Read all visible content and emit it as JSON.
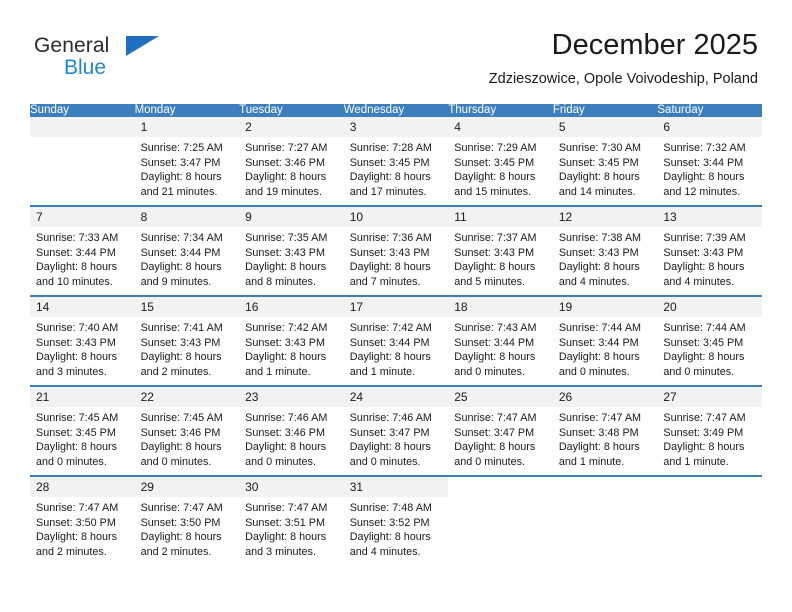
{
  "brand": {
    "name_part1": "General",
    "name_part2": "Blue",
    "color_dark": "#2b2b2b",
    "color_blue": "#1f86d6",
    "triangle_color": "#1f6fc0"
  },
  "header": {
    "title": "December 2025",
    "location": "Zdzieszowice, Opole Voivodeship, Poland"
  },
  "calendar": {
    "accent_color": "#3d7ebd",
    "daynum_band_color": "#f2f2f2",
    "weekday_headers": [
      "Sunday",
      "Monday",
      "Tuesday",
      "Wednesday",
      "Thursday",
      "Friday",
      "Saturday"
    ],
    "weeks": [
      [
        {
          "day": "",
          "empty": true
        },
        {
          "day": "1",
          "sunrise": "Sunrise: 7:25 AM",
          "sunset": "Sunset: 3:47 PM",
          "daylight_line1": "Daylight: 8 hours",
          "daylight_line2": "and 21 minutes."
        },
        {
          "day": "2",
          "sunrise": "Sunrise: 7:27 AM",
          "sunset": "Sunset: 3:46 PM",
          "daylight_line1": "Daylight: 8 hours",
          "daylight_line2": "and 19 minutes."
        },
        {
          "day": "3",
          "sunrise": "Sunrise: 7:28 AM",
          "sunset": "Sunset: 3:45 PM",
          "daylight_line1": "Daylight: 8 hours",
          "daylight_line2": "and 17 minutes."
        },
        {
          "day": "4",
          "sunrise": "Sunrise: 7:29 AM",
          "sunset": "Sunset: 3:45 PM",
          "daylight_line1": "Daylight: 8 hours",
          "daylight_line2": "and 15 minutes."
        },
        {
          "day": "5",
          "sunrise": "Sunrise: 7:30 AM",
          "sunset": "Sunset: 3:45 PM",
          "daylight_line1": "Daylight: 8 hours",
          "daylight_line2": "and 14 minutes."
        },
        {
          "day": "6",
          "sunrise": "Sunrise: 7:32 AM",
          "sunset": "Sunset: 3:44 PM",
          "daylight_line1": "Daylight: 8 hours",
          "daylight_line2": "and 12 minutes."
        }
      ],
      [
        {
          "day": "7",
          "sunrise": "Sunrise: 7:33 AM",
          "sunset": "Sunset: 3:44 PM",
          "daylight_line1": "Daylight: 8 hours",
          "daylight_line2": "and 10 minutes."
        },
        {
          "day": "8",
          "sunrise": "Sunrise: 7:34 AM",
          "sunset": "Sunset: 3:44 PM",
          "daylight_line1": "Daylight: 8 hours",
          "daylight_line2": "and 9 minutes."
        },
        {
          "day": "9",
          "sunrise": "Sunrise: 7:35 AM",
          "sunset": "Sunset: 3:43 PM",
          "daylight_line1": "Daylight: 8 hours",
          "daylight_line2": "and 8 minutes."
        },
        {
          "day": "10",
          "sunrise": "Sunrise: 7:36 AM",
          "sunset": "Sunset: 3:43 PM",
          "daylight_line1": "Daylight: 8 hours",
          "daylight_line2": "and 7 minutes."
        },
        {
          "day": "11",
          "sunrise": "Sunrise: 7:37 AM",
          "sunset": "Sunset: 3:43 PM",
          "daylight_line1": "Daylight: 8 hours",
          "daylight_line2": "and 5 minutes."
        },
        {
          "day": "12",
          "sunrise": "Sunrise: 7:38 AM",
          "sunset": "Sunset: 3:43 PM",
          "daylight_line1": "Daylight: 8 hours",
          "daylight_line2": "and 4 minutes."
        },
        {
          "day": "13",
          "sunrise": "Sunrise: 7:39 AM",
          "sunset": "Sunset: 3:43 PM",
          "daylight_line1": "Daylight: 8 hours",
          "daylight_line2": "and 4 minutes."
        }
      ],
      [
        {
          "day": "14",
          "sunrise": "Sunrise: 7:40 AM",
          "sunset": "Sunset: 3:43 PM",
          "daylight_line1": "Daylight: 8 hours",
          "daylight_line2": "and 3 minutes."
        },
        {
          "day": "15",
          "sunrise": "Sunrise: 7:41 AM",
          "sunset": "Sunset: 3:43 PM",
          "daylight_line1": "Daylight: 8 hours",
          "daylight_line2": "and 2 minutes."
        },
        {
          "day": "16",
          "sunrise": "Sunrise: 7:42 AM",
          "sunset": "Sunset: 3:43 PM",
          "daylight_line1": "Daylight: 8 hours",
          "daylight_line2": "and 1 minute."
        },
        {
          "day": "17",
          "sunrise": "Sunrise: 7:42 AM",
          "sunset": "Sunset: 3:44 PM",
          "daylight_line1": "Daylight: 8 hours",
          "daylight_line2": "and 1 minute."
        },
        {
          "day": "18",
          "sunrise": "Sunrise: 7:43 AM",
          "sunset": "Sunset: 3:44 PM",
          "daylight_line1": "Daylight: 8 hours",
          "daylight_line2": "and 0 minutes."
        },
        {
          "day": "19",
          "sunrise": "Sunrise: 7:44 AM",
          "sunset": "Sunset: 3:44 PM",
          "daylight_line1": "Daylight: 8 hours",
          "daylight_line2": "and 0 minutes."
        },
        {
          "day": "20",
          "sunrise": "Sunrise: 7:44 AM",
          "sunset": "Sunset: 3:45 PM",
          "daylight_line1": "Daylight: 8 hours",
          "daylight_line2": "and 0 minutes."
        }
      ],
      [
        {
          "day": "21",
          "sunrise": "Sunrise: 7:45 AM",
          "sunset": "Sunset: 3:45 PM",
          "daylight_line1": "Daylight: 8 hours",
          "daylight_line2": "and 0 minutes."
        },
        {
          "day": "22",
          "sunrise": "Sunrise: 7:45 AM",
          "sunset": "Sunset: 3:46 PM",
          "daylight_line1": "Daylight: 8 hours",
          "daylight_line2": "and 0 minutes."
        },
        {
          "day": "23",
          "sunrise": "Sunrise: 7:46 AM",
          "sunset": "Sunset: 3:46 PM",
          "daylight_line1": "Daylight: 8 hours",
          "daylight_line2": "and 0 minutes."
        },
        {
          "day": "24",
          "sunrise": "Sunrise: 7:46 AM",
          "sunset": "Sunset: 3:47 PM",
          "daylight_line1": "Daylight: 8 hours",
          "daylight_line2": "and 0 minutes."
        },
        {
          "day": "25",
          "sunrise": "Sunrise: 7:47 AM",
          "sunset": "Sunset: 3:47 PM",
          "daylight_line1": "Daylight: 8 hours",
          "daylight_line2": "and 0 minutes."
        },
        {
          "day": "26",
          "sunrise": "Sunrise: 7:47 AM",
          "sunset": "Sunset: 3:48 PM",
          "daylight_line1": "Daylight: 8 hours",
          "daylight_line2": "and 1 minute."
        },
        {
          "day": "27",
          "sunrise": "Sunrise: 7:47 AM",
          "sunset": "Sunset: 3:49 PM",
          "daylight_line1": "Daylight: 8 hours",
          "daylight_line2": "and 1 minute."
        }
      ],
      [
        {
          "day": "28",
          "sunrise": "Sunrise: 7:47 AM",
          "sunset": "Sunset: 3:50 PM",
          "daylight_line1": "Daylight: 8 hours",
          "daylight_line2": "and 2 minutes."
        },
        {
          "day": "29",
          "sunrise": "Sunrise: 7:47 AM",
          "sunset": "Sunset: 3:50 PM",
          "daylight_line1": "Daylight: 8 hours",
          "daylight_line2": "and 2 minutes."
        },
        {
          "day": "30",
          "sunrise": "Sunrise: 7:47 AM",
          "sunset": "Sunset: 3:51 PM",
          "daylight_line1": "Daylight: 8 hours",
          "daylight_line2": "and 3 minutes."
        },
        {
          "day": "31",
          "sunrise": "Sunrise: 7:48 AM",
          "sunset": "Sunset: 3:52 PM",
          "daylight_line1": "Daylight: 8 hours",
          "daylight_line2": "and 4 minutes."
        },
        {
          "day": "",
          "empty": true,
          "blank": true
        },
        {
          "day": "",
          "empty": true,
          "blank": true
        },
        {
          "day": "",
          "empty": true,
          "blank": true
        }
      ]
    ]
  }
}
